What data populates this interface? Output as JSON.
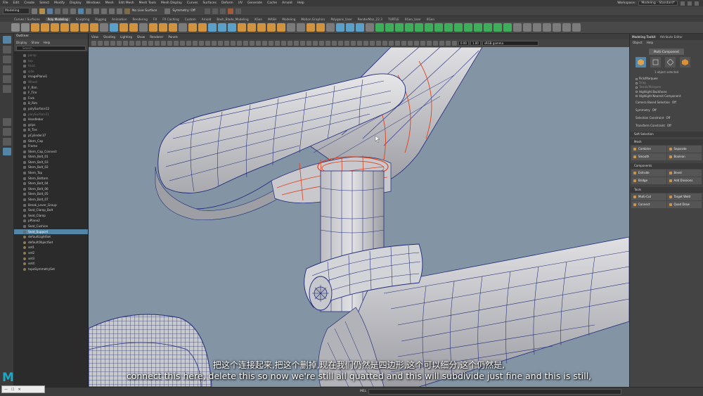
{
  "menubar": {
    "items": [
      "File",
      "Edit",
      "Create",
      "Select",
      "Modify",
      "Display",
      "Windows",
      "Mesh",
      "Edit Mesh",
      "Mesh Tools",
      "Mesh Display",
      "Curves",
      "Surfaces",
      "Deform",
      "UV",
      "Generate",
      "Cache",
      "Arnold",
      "Help"
    ],
    "workspace_label": "Workspace:",
    "workspace_value": "Modeling - Standard*"
  },
  "statusline": {
    "mode": "Modeling",
    "no_live_surface": "No Live Surface",
    "symmetry": "Symmetry: Off"
  },
  "shelf_tabs": [
    "Curves / Surfaces",
    "Poly Modeling",
    "Sculpting",
    "Rigging",
    "Animation",
    "Rendering",
    "FX",
    "FX Caching",
    "Custom",
    "Arnold",
    "Bash_Blade_Modeling",
    "XGen",
    "MASH",
    "Modeling",
    "Motion Graphics",
    "Polygons_User",
    "RenderMan_22.3",
    "TURTLE",
    "XGen_User",
    "XGen"
  ],
  "active_shelf_tab": "Poly Modeling",
  "outliner": {
    "title": "Outliner",
    "menu": [
      "Display",
      "Show",
      "Help"
    ],
    "search_placeholder": "Search...",
    "items": [
      {
        "label": "persp",
        "state": "dim"
      },
      {
        "label": "top",
        "state": "dim"
      },
      {
        "label": "front",
        "state": "dim"
      },
      {
        "label": "side",
        "state": "dim"
      },
      {
        "label": "imagePlane1",
        "state": ""
      },
      {
        "label": "Wheel",
        "state": "dim"
      },
      {
        "label": "F_Rim",
        "state": ""
      },
      {
        "label": "F_Tire",
        "state": ""
      },
      {
        "label": "Fork",
        "state": ""
      },
      {
        "label": "B_Rim",
        "state": ""
      },
      {
        "label": "polySurface12",
        "state": ""
      },
      {
        "label": "polySurface11",
        "state": "dim"
      },
      {
        "label": "Handlebar",
        "state": ""
      },
      {
        "label": "grips",
        "state": ""
      },
      {
        "label": "B_Tire",
        "state": ""
      },
      {
        "label": "pCylinder37",
        "state": ""
      },
      {
        "label": "Stem_Cap",
        "state": ""
      },
      {
        "label": "Frame",
        "state": ""
      },
      {
        "label": "Stem_Cap_Connect",
        "state": ""
      },
      {
        "label": "Stem_Bolt_01",
        "state": ""
      },
      {
        "label": "Stem_Bolt_03",
        "state": ""
      },
      {
        "label": "Stem_Bolt_02",
        "state": ""
      },
      {
        "label": "Stem_Top",
        "state": ""
      },
      {
        "label": "Stem_Bottom",
        "state": ""
      },
      {
        "label": "Stem_Bolt_04",
        "state": ""
      },
      {
        "label": "Stem_Bolt_06",
        "state": ""
      },
      {
        "label": "Stem_Bolt_05",
        "state": ""
      },
      {
        "label": "Stem_Bolt_07",
        "state": ""
      },
      {
        "label": "Break_Lever_Group",
        "state": ""
      },
      {
        "label": "Seat_Clamp_Bolt",
        "state": ""
      },
      {
        "label": "Seat_Clamp",
        "state": ""
      },
      {
        "label": "pPlane2",
        "state": ""
      },
      {
        "label": "Seat_Cushion",
        "state": ""
      },
      {
        "label": "Seat_Support",
        "state": "sel"
      },
      {
        "label": "defaultLightSet",
        "state": "set"
      },
      {
        "label": "defaultObjectSet",
        "state": "set"
      },
      {
        "label": "set1",
        "state": "set"
      },
      {
        "label": "set2",
        "state": "set"
      },
      {
        "label": "set3",
        "state": "set"
      },
      {
        "label": "set4",
        "state": "set"
      },
      {
        "label": "topoSymmetrySet",
        "state": "set"
      }
    ]
  },
  "viewport": {
    "panel_menu": [
      "View",
      "Shading",
      "Lighting",
      "Show",
      "Renderer",
      "Panels"
    ],
    "field_a": "0.00",
    "field_b": "1.00",
    "colorspace": "sRGB gamma"
  },
  "subtitles": {
    "chinese": "把这个连接起来,把这个删掉,现在我们仍然是四边形,这个可以细分,这个仍然是,",
    "english": "connect this here, delete this so now we're still all quatted and this will subdivide just fine and this is still,"
  },
  "modeling_toolkit": {
    "tabs": [
      "Modeling Toolkit",
      "Attribute Editor"
    ],
    "menu": [
      "Object",
      "Help"
    ],
    "multi_component": "Multi-Component",
    "selection_info": "1 object selected",
    "pick_options": [
      {
        "label": "Pick/Marquee",
        "state": ""
      },
      {
        "label": "Drag",
        "state": "dim"
      },
      {
        "label": "Tweak/Marquee",
        "state": "dim"
      },
      {
        "label": "Highlight Backfaces",
        "state": ""
      },
      {
        "label": "Highlight Nearest Component",
        "state": ""
      }
    ],
    "camera_based": {
      "label": "Camera Based Selection",
      "value": "Off"
    },
    "symmetry": {
      "label": "Symmetry",
      "value": "Off"
    },
    "selection_constraint": {
      "label": "Selection Constraint",
      "value": "Off"
    },
    "transform_constraint": {
      "label": "Transform Constraint",
      "value": "Off"
    },
    "soft_selection": "Soft Selection",
    "mesh_header": "Mesh",
    "mesh_buttons": [
      "Combine",
      "Separate",
      "Smooth",
      "Boolean"
    ],
    "components_header": "Components",
    "component_buttons": [
      "Extrude",
      "Bevel",
      "Bridge",
      "Add Divisions"
    ],
    "tools_header": "Tools",
    "tool_buttons": [
      "Multi-Cut",
      "Target Weld",
      "Connect",
      "Quad Draw"
    ]
  },
  "bottom": {
    "mel_label": "MEL",
    "logo_letter": "M",
    "window_controls": [
      "—",
      "☐",
      "✕"
    ]
  },
  "colors": {
    "viewport_bg": "#8394a4",
    "selection_blue": "#5285a6",
    "wire_dark": "#1f2a7a",
    "highlight_orange": "#e0401a",
    "mesh_grey": "#d9d9dc",
    "maya_teal": "#1ba8c3"
  }
}
